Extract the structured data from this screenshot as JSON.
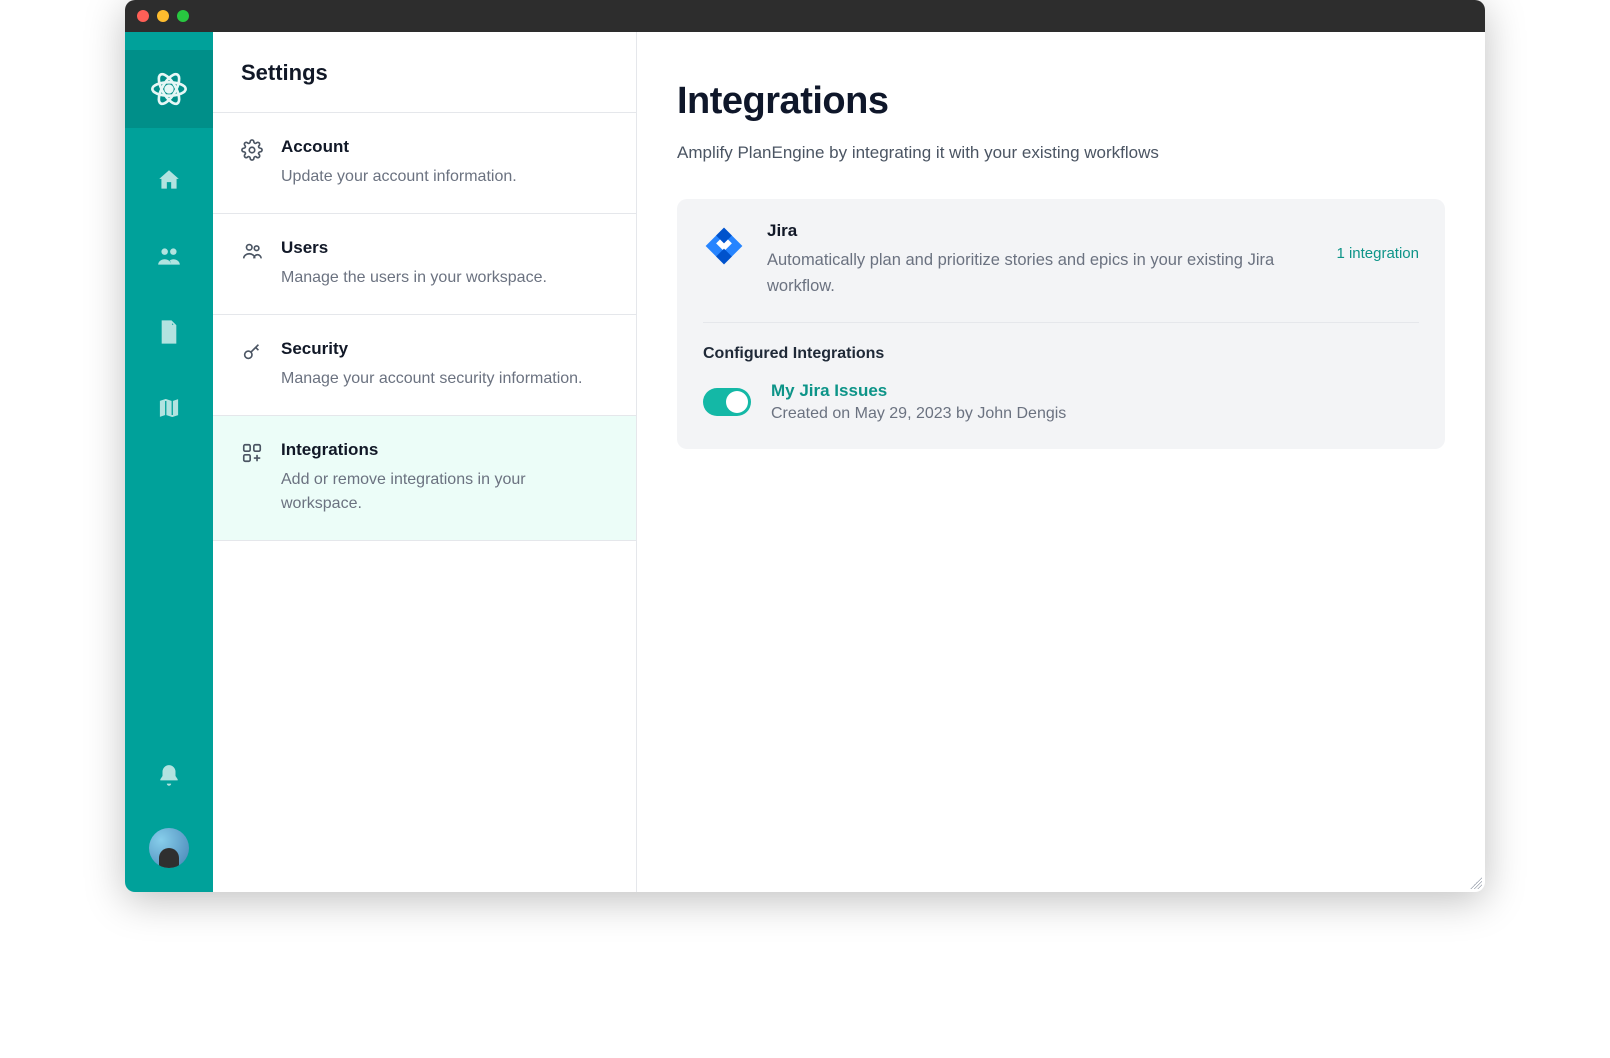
{
  "settings": {
    "title": "Settings",
    "items": [
      {
        "title": "Account",
        "desc": "Update your account information."
      },
      {
        "title": "Users",
        "desc": "Manage the users in your workspace."
      },
      {
        "title": "Security",
        "desc": "Manage your account security information."
      },
      {
        "title": "Integrations",
        "desc": "Add or remove integrations in your workspace."
      }
    ]
  },
  "main": {
    "title": "Integrations",
    "subtitle": "Amplify PlanEngine by integrating it with your existing workflows",
    "card": {
      "providerName": "Jira",
      "providerDesc": "Automatically plan and prioritize stories and epics in your existing Jira workflow.",
      "countLabel": "1 integration",
      "configuredTitle": "Configured Integrations",
      "integration": {
        "name": "My Jira Issues",
        "meta": "Created on May 29, 2023 by John Dengis"
      }
    }
  }
}
